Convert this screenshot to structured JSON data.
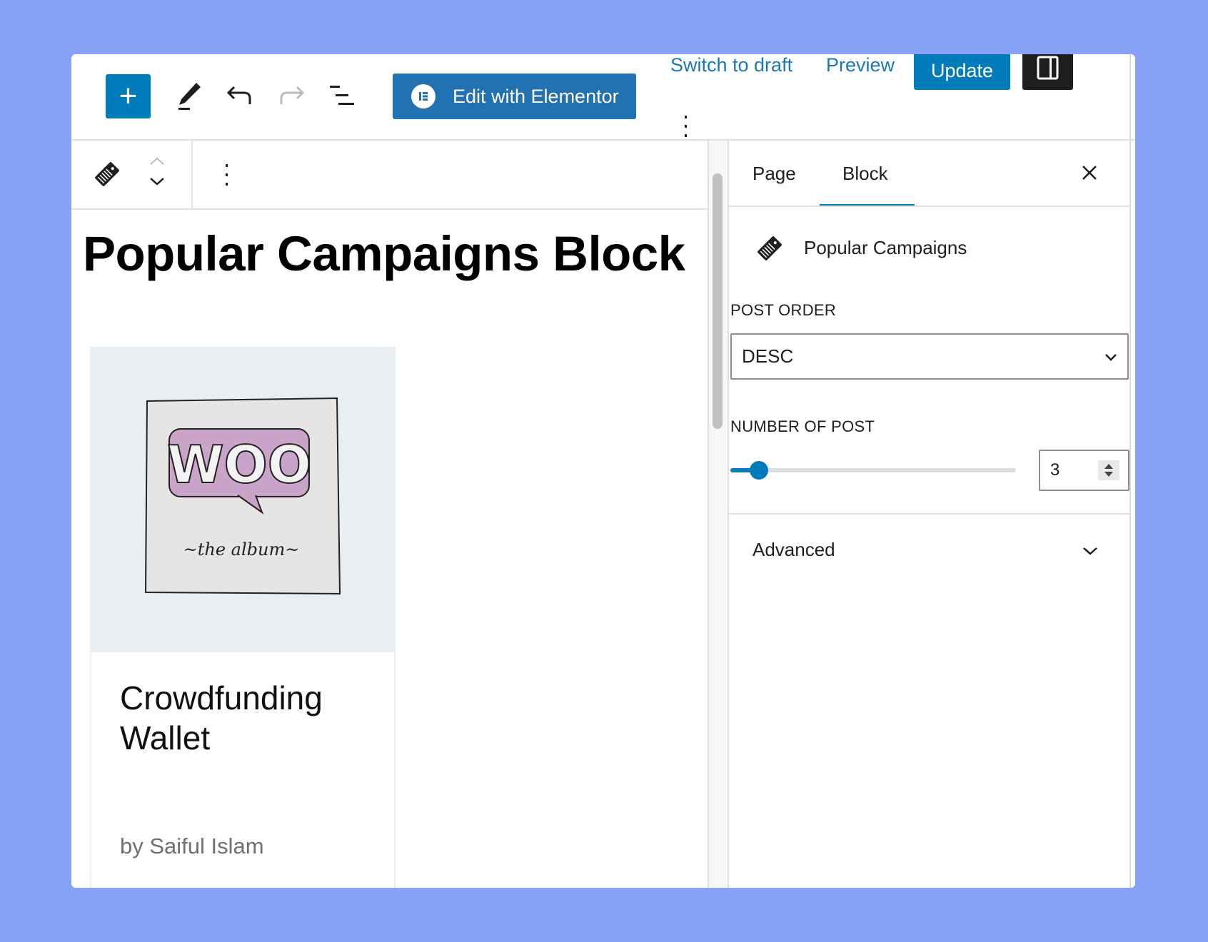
{
  "header": {
    "add_label": "+",
    "elementor_label": "Edit with Elementor",
    "switch_to_draft": "Switch to draft",
    "preview": "Preview",
    "update": "Update"
  },
  "content": {
    "title": "Popular Campaigns Block",
    "card": {
      "image_logo_text": [
        "WOO",
        "the album"
      ],
      "title_line1": "Crowdfunding",
      "title_line2": "Wallet",
      "author": "by Saiful Islam"
    }
  },
  "sidebar": {
    "tabs": [
      {
        "label": "Page",
        "active": false
      },
      {
        "label": "Block",
        "active": true
      }
    ],
    "block_name": "Popular Campaigns",
    "post_order_label": "POST ORDER",
    "post_order_value": "DESC",
    "number_label": "NUMBER OF POST",
    "number_value": "3",
    "slider_fraction": 0.1,
    "advanced_label": "Advanced"
  },
  "colors": {
    "accent": "#007cba",
    "background": "#87a2f6",
    "dark": "#1e1e1e"
  }
}
